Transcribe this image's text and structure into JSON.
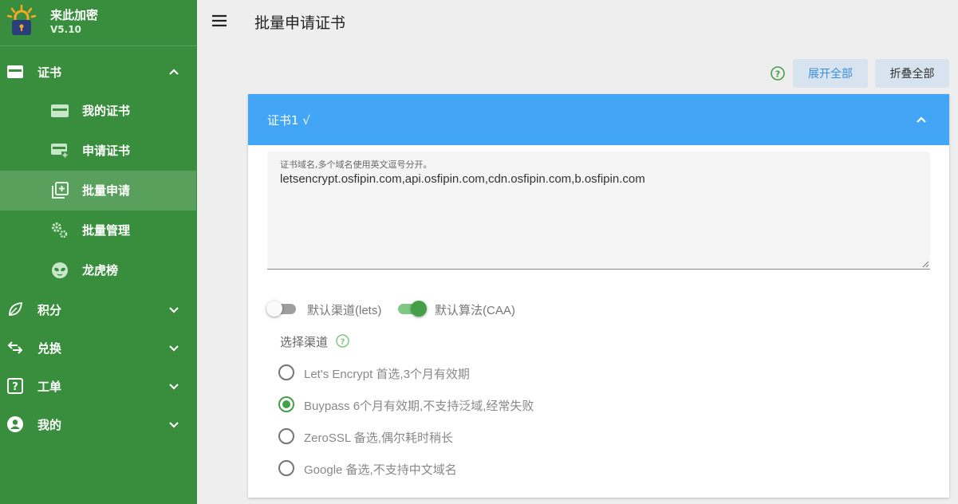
{
  "brand": {
    "title": "来此加密",
    "version": "V5.10"
  },
  "sidebar": {
    "items": [
      {
        "label": "证书",
        "icon": "card-icon",
        "expanded": true
      },
      {
        "label": "积分",
        "icon": "leaf-icon"
      },
      {
        "label": "兑换",
        "icon": "swap-icon"
      },
      {
        "label": "工单",
        "icon": "question-box-icon"
      },
      {
        "label": "我的",
        "icon": "account-icon"
      }
    ],
    "sub_items": [
      {
        "label": "我的证书",
        "icon": "card-icon"
      },
      {
        "label": "申请证书",
        "icon": "card-plus-icon"
      },
      {
        "label": "批量申请",
        "icon": "copy-plus-icon",
        "active": true
      },
      {
        "label": "批量管理",
        "icon": "gears-icon"
      },
      {
        "label": "龙虎榜",
        "icon": "alien-icon"
      }
    ]
  },
  "header": {
    "title": "批量申请证书"
  },
  "toolbar": {
    "expand_label": "展开全部",
    "collapse_label": "折叠全部"
  },
  "card": {
    "title": "证书1 √",
    "domains_label": "证书域名,多个域名使用英文逗号分开。",
    "domains_value": "letsencrypt.osfipin.com,api.osfipin.com,cdn.osfipin.com,b.osfipin.com",
    "switch_channel": {
      "label": "默认渠道(lets)",
      "on": false
    },
    "switch_algo": {
      "label": "默认算法(CAA)",
      "on": true
    },
    "channel_label": "选择渠道",
    "channels": [
      {
        "label": "Let's Encrypt 首选,3个月有效期",
        "checked": false
      },
      {
        "label": "Buypass 6个月有效期,不支持泛域,经常失败",
        "checked": true
      },
      {
        "label": "ZeroSSL 备选,偶尔耗时稍长",
        "checked": false
      },
      {
        "label": "Google 备选,不支持中文域名",
        "checked": false
      }
    ]
  },
  "colors": {
    "sidebar": "#388e3c",
    "card_header": "#42a5f5",
    "accent_green": "#43a047",
    "button_bg": "#d7e3ee",
    "link_blue": "#3a8fd6"
  }
}
